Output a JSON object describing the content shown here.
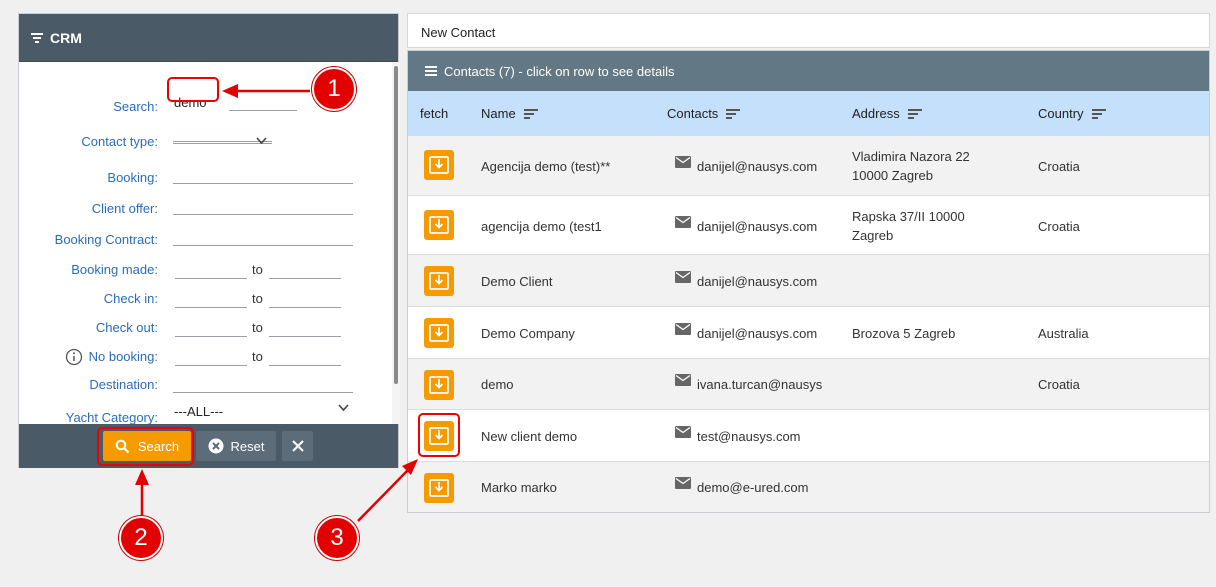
{
  "crm": {
    "title": "CRM",
    "labels": {
      "search": "Search:",
      "contact_type": "Contact type:",
      "booking": "Booking:",
      "client_offer": "Client offer:",
      "booking_contract": "Booking Contract:",
      "booking_made": "Booking made:",
      "check_in": "Check in:",
      "check_out": "Check out:",
      "no_booking": "No booking:",
      "destination": "Destination:",
      "yacht_category": "Yacht Category:"
    },
    "to_label": "to",
    "search_value": "demo",
    "yacht_category_value": "---ALL---",
    "buttons": {
      "search": "Search",
      "reset": "Reset"
    }
  },
  "contact_bar": {
    "label": "New Contact"
  },
  "contacts": {
    "header": "Contacts (7) - click on row to see details",
    "columns": {
      "fetch": "fetch",
      "name": "Name",
      "contacts": "Contacts",
      "address": "Address",
      "country": "Country"
    },
    "rows": [
      {
        "name": "Agencija demo (test)**",
        "email": "danijel@nausys.com",
        "address_1": "Vladimira Nazora 22",
        "address_2": "10000 Zagreb",
        "country": "Croatia"
      },
      {
        "name": "agencija demo (test1",
        "email": "danijel@nausys.com",
        "address_1": "Rapska 37/II 10000",
        "address_2": "Zagreb",
        "country": "Croatia"
      },
      {
        "name": "Demo Client",
        "email": "danijel@nausys.com",
        "address_1": "",
        "address_2": "",
        "country": ""
      },
      {
        "name": "Demo Company",
        "email": "danijel@nausys.com",
        "address_1": "Brozova 5 Zagreb",
        "address_2": "",
        "country": "Australia"
      },
      {
        "name": "demo",
        "email": "ivana.turcan@nausys",
        "address_1": "",
        "address_2": "",
        "country": "Croatia"
      },
      {
        "name": "New client demo",
        "email": "test@nausys.com",
        "address_1": "",
        "address_2": "",
        "country": ""
      },
      {
        "name": "Marko marko",
        "email": "demo@e-ured.com",
        "address_1": "",
        "address_2": "",
        "country": ""
      }
    ]
  },
  "annotations": {
    "badge_1": "1",
    "badge_2": "2",
    "badge_3": "3",
    "color": "#e30000"
  }
}
